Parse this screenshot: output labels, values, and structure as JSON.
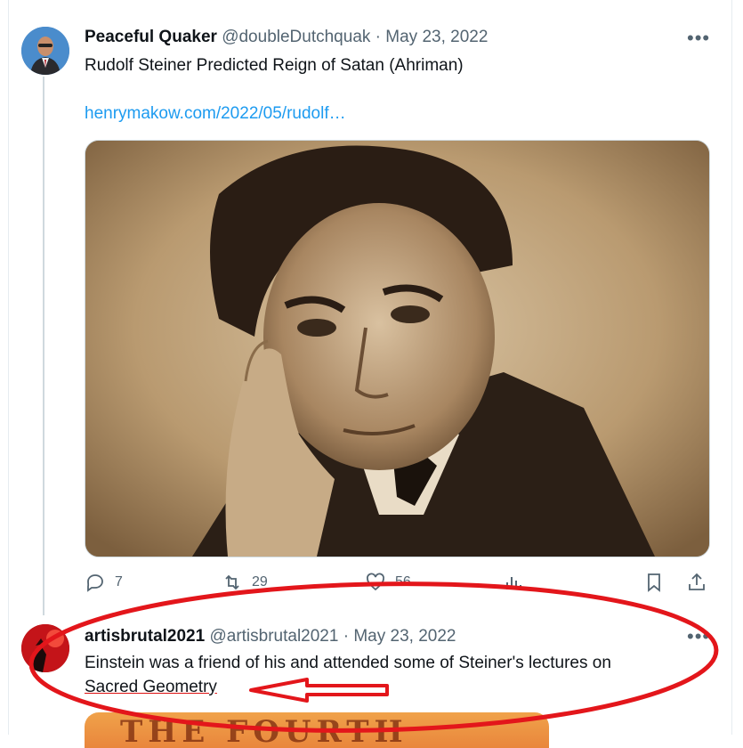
{
  "tweet1": {
    "name": "Peaceful Quaker",
    "handle": "@doubleDutchquak",
    "separator": "·",
    "date": "May 23, 2022",
    "text": "Rudolf Steiner Predicted Reign of Satan (Ahriman)",
    "link": "henrymakow.com/2022/05/rudolf…",
    "more": "•••",
    "actions": {
      "replies": "7",
      "retweets": "29",
      "likes": "56"
    }
  },
  "tweet2": {
    "name": "artisbrutal2021",
    "handle": "@artisbrutal2021",
    "separator": "·",
    "date": "May 23, 2022",
    "text_line1": "Einstein was a friend of his and attended some of Steiner's lectures on",
    "text_line2": "Sacred Geometry",
    "more": "•••",
    "media_text": "THE FOURTH"
  },
  "colors": {
    "text": "#0f1419",
    "muted": "#536471",
    "link": "#1d9bf0",
    "annotation": "#e3161b"
  },
  "icons": [
    "more-icon",
    "reply-icon",
    "retweet-icon",
    "like-icon",
    "views-icon",
    "bookmark-icon",
    "share-icon",
    "arrow-annotation-icon"
  ]
}
